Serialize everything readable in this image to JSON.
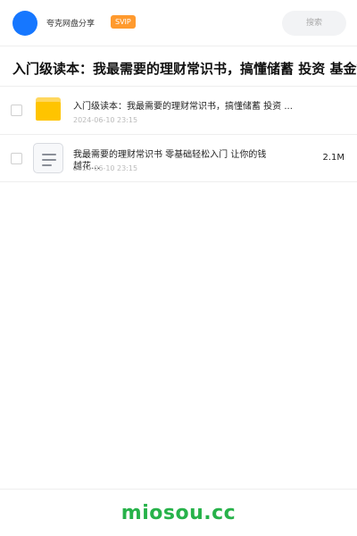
{
  "header": {
    "app_name": "夸克网盘分享",
    "badge": "SVIP",
    "search_placeholder": "搜索"
  },
  "share": {
    "title": "入门级读本：我最需要的理财常识书，搞懂储蓄 投资 基金等"
  },
  "files": [
    {
      "type": "folder",
      "icon": "folder-icon",
      "name": "入门级读本：我最需要的理财常识书，搞懂储蓄 投资 ...",
      "date": "2024-06-10 23:15",
      "size": ""
    },
    {
      "type": "document",
      "icon": "document-icon",
      "name": "我最需要的理财常识书 零基础轻松入门 让你的钱越花…",
      "date": "2024-06-10 23:15",
      "size": "2.1M"
    }
  ],
  "footer": {
    "watermark": "miosou.cc"
  },
  "colors": {
    "accent": "#1677ff",
    "badge": "#ff9a2e",
    "folder": "#ffc400",
    "watermark": "#27b24a"
  }
}
